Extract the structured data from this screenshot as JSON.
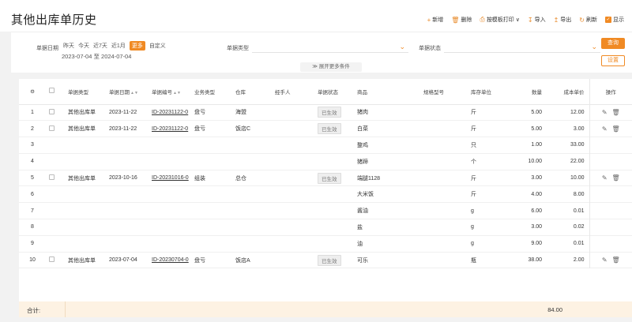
{
  "header": {
    "title": "其他出库单历史",
    "toolbar": [
      {
        "name": "add-button",
        "icon": "plus-icon",
        "glyph": "+",
        "label": "新增"
      },
      {
        "name": "delete-button",
        "icon": "trash-icon",
        "glyph": "🗑",
        "label": "删除"
      },
      {
        "name": "print-template-button",
        "icon": "printer-icon",
        "glyph": "⎙",
        "label": "按模板打印 ∨"
      },
      {
        "name": "import-button",
        "icon": "import-icon",
        "glyph": "↧",
        "label": "导入"
      },
      {
        "name": "export-button",
        "icon": "export-icon",
        "glyph": "↥",
        "label": "导出"
      },
      {
        "name": "refresh-button",
        "icon": "refresh-icon",
        "glyph": "↻",
        "label": "刷新"
      },
      {
        "name": "show-toggle",
        "icon": "checkbox-icon",
        "glyph": "✓",
        "label": "显示"
      }
    ]
  },
  "filter": {
    "date_label": "单据日期",
    "quick": [
      "昨天",
      "今天",
      "近7天",
      "近1月",
      "更多",
      "自定义"
    ],
    "active_quick": "更多",
    "date_range": "2023-07-04 至 2024-07-04",
    "type_label": "单据类型",
    "status_label": "单据状态",
    "query_button": "查询",
    "setting_button": "设置",
    "expand_label": "≫ 展开更多条件"
  },
  "table": {
    "columns": [
      "⚙",
      "",
      "单据类型",
      "单据日期",
      "单据编号",
      "业务类型",
      "仓库",
      "经手人",
      "单据状态",
      "商品",
      "规格型号",
      "库存单位",
      "数量",
      "成本单价",
      "操作"
    ],
    "rows": [
      {
        "idx": "1",
        "check": true,
        "type": "其他出库单",
        "date": "2023-11-22",
        "code": "ID-20231122-0",
        "biz": "盘亏",
        "wh": "海盟",
        "handler": "",
        "status": "已生效",
        "goods": "猪肉",
        "spec": "",
        "unit": "斤",
        "qty": "5.00",
        "price": "12.00",
        "ops": true
      },
      {
        "idx": "2",
        "check": true,
        "type": "其他出库单",
        "date": "2023-11-22",
        "code": "ID-20231122-0",
        "biz": "盘亏",
        "wh": "饭店C",
        "handler": "",
        "status": "已生效",
        "goods": "白菜",
        "spec": "",
        "unit": "斤",
        "qty": "5.00",
        "price": "3.00",
        "ops": true
      },
      {
        "idx": "3",
        "check": false,
        "type": "",
        "date": "",
        "code": "",
        "biz": "",
        "wh": "",
        "handler": "",
        "status": "",
        "goods": "整鸡",
        "spec": "",
        "unit": "只",
        "qty": "1.00",
        "price": "33.00",
        "ops": false
      },
      {
        "idx": "4",
        "check": false,
        "type": "",
        "date": "",
        "code": "",
        "biz": "",
        "wh": "",
        "handler": "",
        "status": "",
        "goods": "猪蹄",
        "spec": "",
        "unit": "个",
        "qty": "10.00",
        "price": "22.00",
        "ops": false
      },
      {
        "idx": "5",
        "check": true,
        "type": "其他出库单",
        "date": "2023-10-16",
        "code": "ID-20231016-0",
        "biz": "组装",
        "wh": "总仓",
        "handler": "",
        "status": "已生效",
        "goods": "端腿1128",
        "spec": "",
        "unit": "斤",
        "qty": "3.00",
        "price": "10.00",
        "ops": true
      },
      {
        "idx": "6",
        "check": false,
        "type": "",
        "date": "",
        "code": "",
        "biz": "",
        "wh": "",
        "handler": "",
        "status": "",
        "goods": "大米饭",
        "spec": "",
        "unit": "斤",
        "qty": "4.00",
        "price": "8.00",
        "ops": false
      },
      {
        "idx": "7",
        "check": false,
        "type": "",
        "date": "",
        "code": "",
        "biz": "",
        "wh": "",
        "handler": "",
        "status": "",
        "goods": "酱油",
        "spec": "",
        "unit": "g",
        "qty": "6.00",
        "price": "0.01",
        "ops": false
      },
      {
        "idx": "8",
        "check": false,
        "type": "",
        "date": "",
        "code": "",
        "biz": "",
        "wh": "",
        "handler": "",
        "status": "",
        "goods": "盐",
        "spec": "",
        "unit": "g",
        "qty": "3.00",
        "price": "0.02",
        "ops": false
      },
      {
        "idx": "9",
        "check": false,
        "type": "",
        "date": "",
        "code": "",
        "biz": "",
        "wh": "",
        "handler": "",
        "status": "",
        "goods": "油",
        "spec": "",
        "unit": "g",
        "qty": "9.00",
        "price": "0.01",
        "ops": false
      },
      {
        "idx": "10",
        "check": true,
        "type": "其他出库单",
        "date": "2023-07-04",
        "code": "ID-20230704-0",
        "biz": "盘亏",
        "wh": "饭店A",
        "handler": "",
        "status": "已生效",
        "goods": "可乐",
        "spec": "",
        "unit": "瓶",
        "qty": "38.00",
        "price": "2.00",
        "ops": true
      }
    ]
  },
  "footer": {
    "label": "合计:",
    "qty_total": "84.00"
  },
  "colors": {
    "accent": "#f08a24",
    "total_bg": "#fdf2e3"
  }
}
